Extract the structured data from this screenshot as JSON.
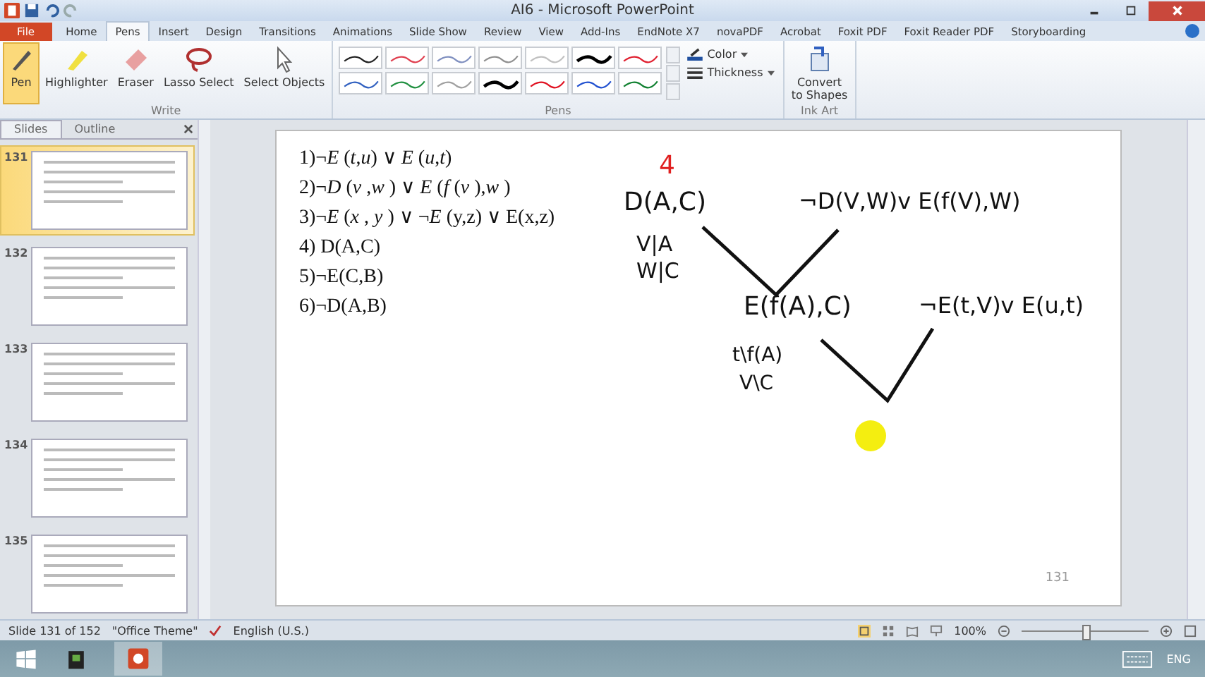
{
  "window": {
    "title": "AI6 - Microsoft PowerPoint"
  },
  "tabs": [
    {
      "label": "File",
      "selected": false,
      "kind": "file"
    },
    {
      "label": "Home",
      "selected": false,
      "kind": "tab"
    },
    {
      "label": "Pens",
      "selected": true,
      "kind": "tab"
    },
    {
      "label": "Insert",
      "selected": false,
      "kind": "tab"
    },
    {
      "label": "Design",
      "selected": false,
      "kind": "tab"
    },
    {
      "label": "Transitions",
      "selected": false,
      "kind": "tab"
    },
    {
      "label": "Animations",
      "selected": false,
      "kind": "tab"
    },
    {
      "label": "Slide Show",
      "selected": false,
      "kind": "tab"
    },
    {
      "label": "Review",
      "selected": false,
      "kind": "tab"
    },
    {
      "label": "View",
      "selected": false,
      "kind": "tab"
    },
    {
      "label": "Add-Ins",
      "selected": false,
      "kind": "tab"
    },
    {
      "label": "EndNote X7",
      "selected": false,
      "kind": "tab"
    },
    {
      "label": "novaPDF",
      "selected": false,
      "kind": "tab"
    },
    {
      "label": "Acrobat",
      "selected": false,
      "kind": "tab"
    },
    {
      "label": "Foxit PDF",
      "selected": false,
      "kind": "tab"
    },
    {
      "label": "Foxit Reader PDF",
      "selected": false,
      "kind": "tab"
    },
    {
      "label": "Storyboarding",
      "selected": false,
      "kind": "tab"
    }
  ],
  "ribbon": {
    "write": {
      "label": "Write",
      "tools": [
        {
          "label": "Pen",
          "selected": true,
          "kind": "pen"
        },
        {
          "label": "Highlighter",
          "selected": false,
          "kind": "highlighter"
        },
        {
          "label": "Eraser",
          "selected": false,
          "kind": "eraser"
        },
        {
          "label": "Lasso Select",
          "selected": false,
          "kind": "lasso"
        },
        {
          "label": "Select Objects",
          "selected": false,
          "kind": "pointer"
        }
      ]
    },
    "pens": {
      "label": "Pens",
      "styles": [
        {
          "color": "#222222"
        },
        {
          "color": "#e04050"
        },
        {
          "color": "#8090c0"
        },
        {
          "color": "#909090"
        },
        {
          "color": "#c0c0c0"
        },
        {
          "color": "#000000"
        },
        {
          "color": "#e02030"
        },
        {
          "color": "#3060c0"
        },
        {
          "color": "#209040"
        },
        {
          "color": "#a0a0a0"
        },
        {
          "color": "#000001"
        },
        {
          "color": "#e01020"
        },
        {
          "color": "#2050d0"
        },
        {
          "color": "#108030"
        }
      ],
      "color_label": "Color",
      "thickness_label": "Thickness"
    },
    "ink_art": {
      "label": "Ink Art",
      "convert": "Convert to Shapes"
    }
  },
  "pane": {
    "tabs": [
      {
        "label": "Slides",
        "selected": true
      },
      {
        "label": "Outline",
        "selected": false
      }
    ],
    "slides": [
      {
        "number": "131",
        "selected": true
      },
      {
        "number": "132",
        "selected": false
      },
      {
        "number": "133",
        "selected": false
      },
      {
        "number": "134",
        "selected": false
      },
      {
        "number": "135",
        "selected": false
      }
    ]
  },
  "slide": {
    "clauses": [
      "1)¬*E* (*t*,*u*) ∨ *E* (*u*,*t*)",
      "2)¬*D* (*v* ,*w* ) ∨ *E* (*f* (*v* ),*w* )",
      "3)¬*E* (*x* , *y* ) ∨ ¬*E* (y,z) ∨ E(x,z)",
      "4) D(A,C)",
      "5)¬E(C,B)",
      "6)¬D(A,B)"
    ],
    "ink": [
      {
        "text": "4",
        "color": "#e02020"
      },
      {
        "text": "D(A,C)",
        "color": "#111111"
      },
      {
        "text": "¬D(V,W)v E(f(V),W)",
        "color": "#111111"
      },
      {
        "text": "V|A",
        "color": "#111111"
      },
      {
        "text": "W|C",
        "color": "#111111"
      },
      {
        "text": "E(f(A),C)",
        "color": "#111111"
      },
      {
        "text": "¬E(t,V)v E(u,t)",
        "color": "#111111"
      },
      {
        "text": "t\\f(A)",
        "color": "#111111"
      },
      {
        "text": "V\\C",
        "color": "#111111"
      }
    ],
    "page_number": "131"
  },
  "status_bar": {
    "slide": "Slide 131 of 152",
    "theme": "\"Office Theme\"",
    "language": "English (U.S.)",
    "zoom": "100%",
    "zoom_slider": {
      "level": 0.5
    }
  },
  "taskbar": {
    "language": "ENG"
  }
}
